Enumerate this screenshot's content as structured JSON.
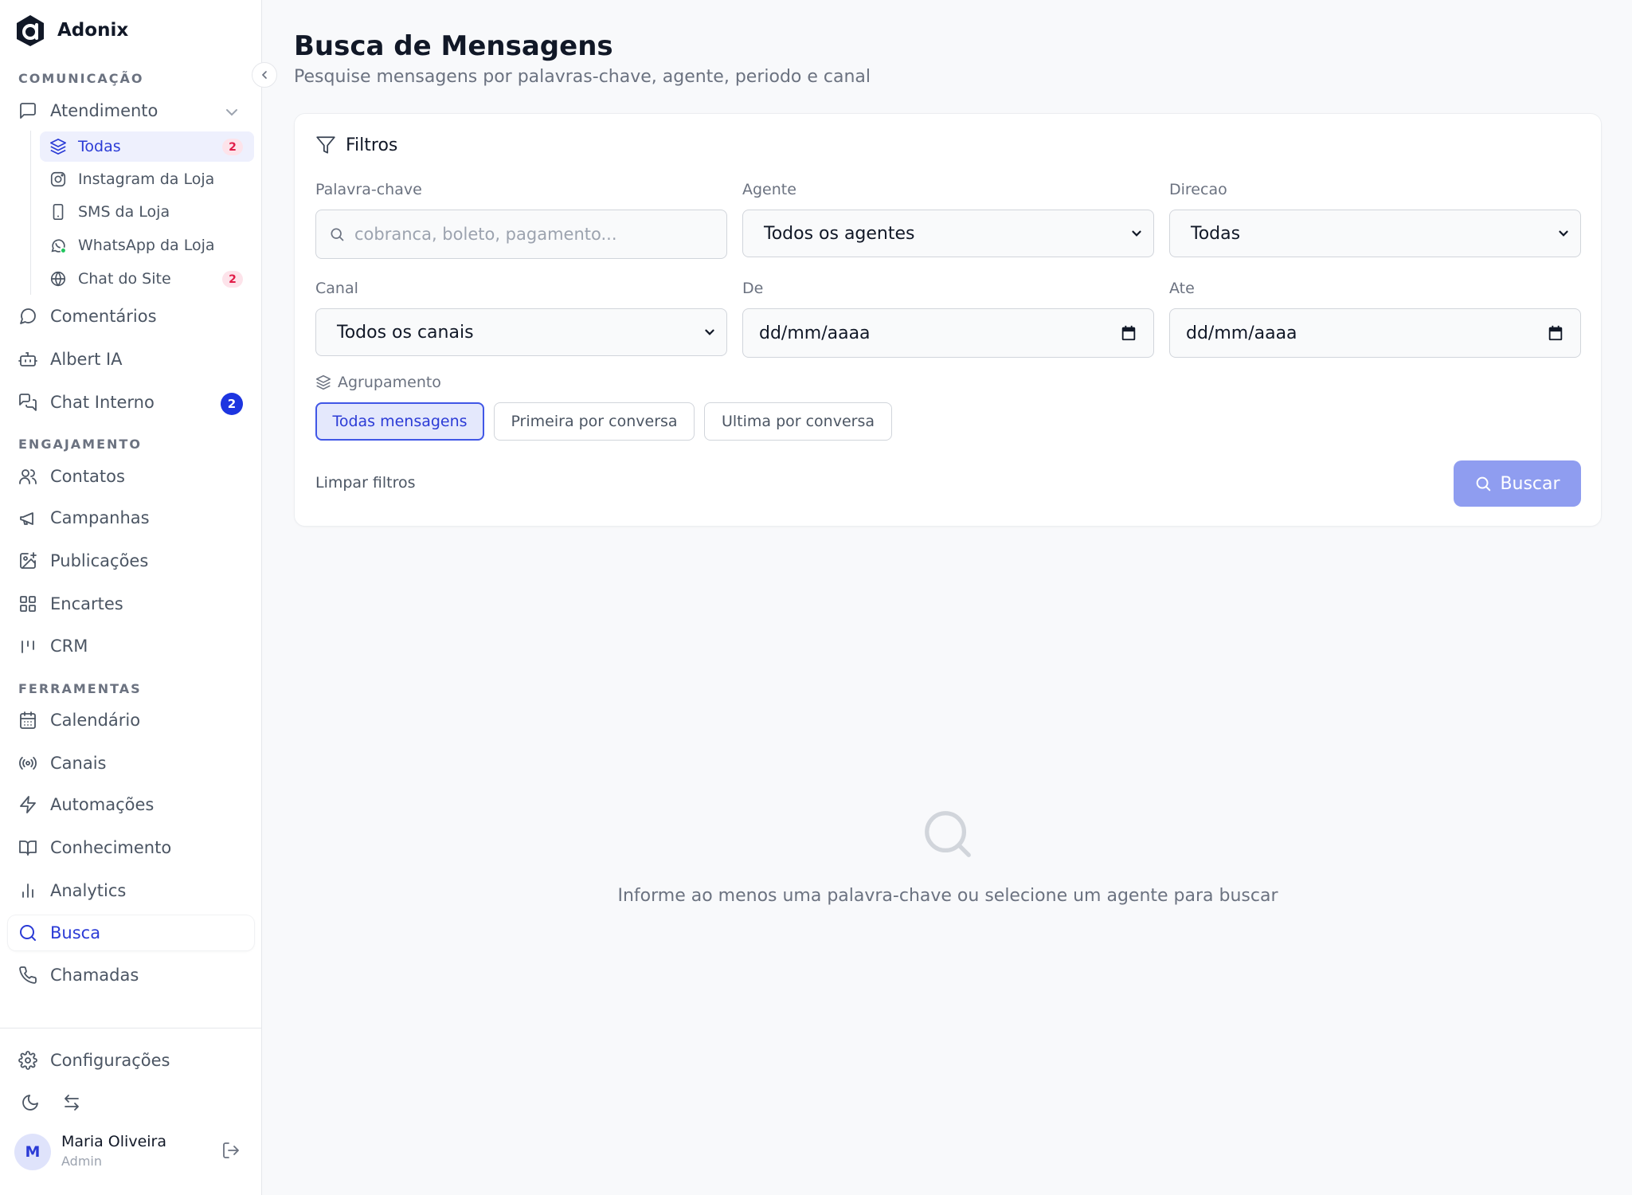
{
  "app": {
    "name": "Adonix"
  },
  "sidebar": {
    "sections": {
      "comunicacao": "COMUNICAÇÃO",
      "engajamento": "ENGAJAMENTO",
      "ferramentas": "FERRAMENTAS"
    },
    "atendimento": {
      "label": "Atendimento",
      "subitems": [
        {
          "label": "Todas",
          "badge": "2"
        },
        {
          "label": "Instagram da Loja"
        },
        {
          "label": "SMS da Loja"
        },
        {
          "label": "WhatsApp da Loja"
        },
        {
          "label": "Chat do Site",
          "badge": "2"
        }
      ]
    },
    "items": {
      "comentarios": "Comentários",
      "albert": "Albert IA",
      "chat_interno": "Chat Interno",
      "chat_interno_badge": "2",
      "contatos": "Contatos",
      "campanhas": "Campanhas",
      "publicacoes": "Publicações",
      "encartes": "Encartes",
      "crm": "CRM",
      "calendario": "Calendário",
      "canais": "Canais",
      "automacoes": "Automações",
      "conhecimento": "Conhecimento",
      "analytics": "Analytics",
      "busca": "Busca",
      "chamadas": "Chamadas"
    },
    "footer": {
      "configuracoes": "Configurações",
      "user": {
        "initial": "M",
        "name": "Maria Oliveira",
        "role": "Admin"
      }
    }
  },
  "main": {
    "title": "Busca de Mensagens",
    "subtitle": "Pesquise mensagens por palavras-chave, agente, periodo e canal",
    "filters": {
      "heading": "Filtros",
      "keyword": {
        "label": "Palavra-chave",
        "placeholder": "cobranca, boleto, pagamento..."
      },
      "agent": {
        "label": "Agente",
        "value": "Todos os agentes"
      },
      "direction": {
        "label": "Direcao",
        "value": "Todas"
      },
      "channel": {
        "label": "Canal",
        "value": "Todos os canais"
      },
      "from": {
        "label": "De",
        "value": "dd/mm/aaaa"
      },
      "to": {
        "label": "Ate",
        "value": "dd/mm/aaaa"
      },
      "grouping": {
        "label": "Agrupamento",
        "options": [
          "Todas mensagens",
          "Primeira por conversa",
          "Ultima por conversa"
        ],
        "selected": "Todas mensagens"
      },
      "clear": "Limpar filtros",
      "search": "Buscar"
    },
    "empty_state": "Informe ao menos uma palavra-chave ou selecione um agente para buscar"
  },
  "colors": {
    "accent": "#2b3bd6",
    "badge_bg": "#fde3ea",
    "badge_text": "#e11d48",
    "button": "#8f9df0"
  }
}
